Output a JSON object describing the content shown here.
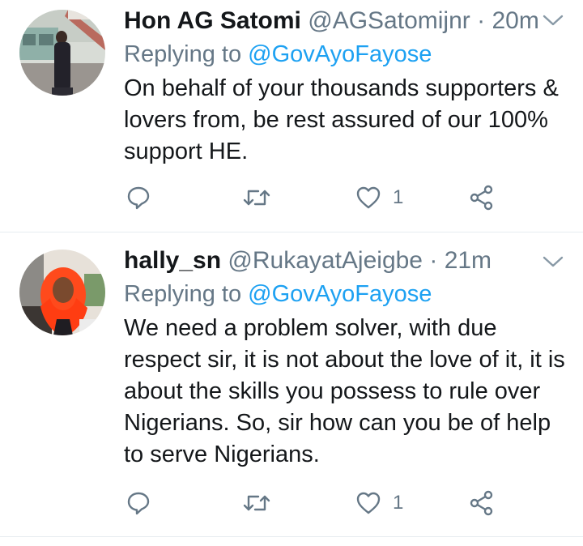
{
  "tweets": [
    {
      "name": "Hon AG Satomi",
      "handle": "@AGSatomijnr",
      "separator": "·",
      "time": "20m",
      "replying_prefix": "Replying to",
      "replying_to": "@GovAyoFayose",
      "text": "On behalf of your thousands supporters & lovers from, be rest assured of our 100% support HE.",
      "like_count": "1"
    },
    {
      "name": "hally_sn",
      "handle": "@RukayatAjeigbe",
      "separator": "·",
      "time": "21m",
      "replying_prefix": "Replying to",
      "replying_to": "@GovAyoFayose",
      "text": "We need a problem solver, with due respect sir, it is not about the love of it, it is about the skills you possess to rule over Nigerians. So, sir how can you be of help to serve Nigerians.",
      "like_count": "1"
    }
  ],
  "icons": {
    "reply": "reply-icon",
    "retweet": "retweet-icon",
    "like": "heart-icon",
    "share": "share-icon",
    "menu": "chevron-down-icon"
  },
  "colors": {
    "text": "#14171a",
    "muted": "#657786",
    "link": "#1da1f2",
    "divider": "#e6ecf0"
  }
}
